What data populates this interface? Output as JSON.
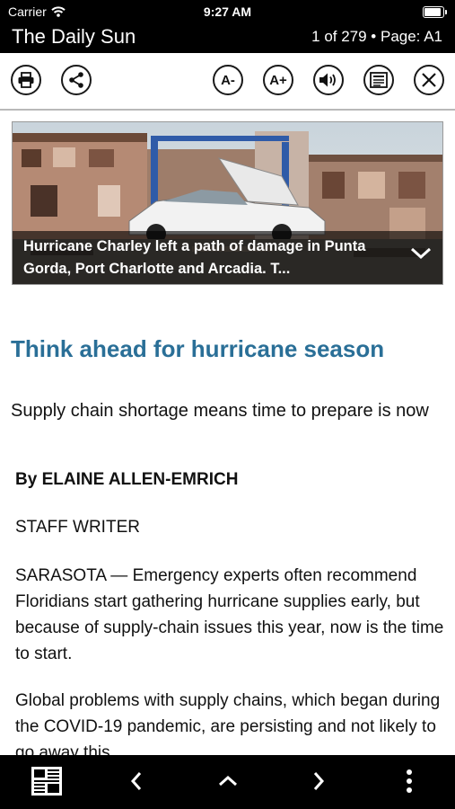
{
  "status_bar": {
    "carrier": "Carrier",
    "time": "9:27 AM",
    "battery_level": 1.0
  },
  "header": {
    "title": "The Daily Sun",
    "page_info": "1 of 279 • Page: A1"
  },
  "toolbar": {
    "print_icon": "printer-icon",
    "share_icon": "share-icon",
    "decrease_text_label": "A-",
    "increase_text_label": "A+",
    "audio_icon": "speaker-icon",
    "text_view_icon": "article-text-icon",
    "close_icon": "close-icon"
  },
  "hero": {
    "caption": "Hurricane Charley left a path of damage in Punta Gorda, Port Charlotte and Arcadia. T...",
    "expand_icon": "chevron-down-icon"
  },
  "article": {
    "headline": "Think ahead for hurricane season",
    "subhead": "Supply chain shortage means time to prepare is now",
    "byline": "By ELAINE ALLEN-EMRICH",
    "role": "STAFF WRITER",
    "paragraphs": [
      "SARASOTA — Emergency experts often recommend Floridians start gathering hurricane supplies early, but because of supply-chain issues this year, now is the time to start.",
      "Global problems with supply chains, which began during the COVID-19 pandemic, are persisting and not likely to go away this"
    ]
  },
  "bottom_bar": {
    "pages_icon": "newspaper-pages-icon",
    "prev_icon": "chevron-left-icon",
    "up_icon": "chevron-up-icon",
    "next_icon": "chevron-right-icon",
    "more_icon": "more-vertical-icon"
  },
  "colors": {
    "headline": "#2a6f97",
    "bars": "#000000"
  }
}
